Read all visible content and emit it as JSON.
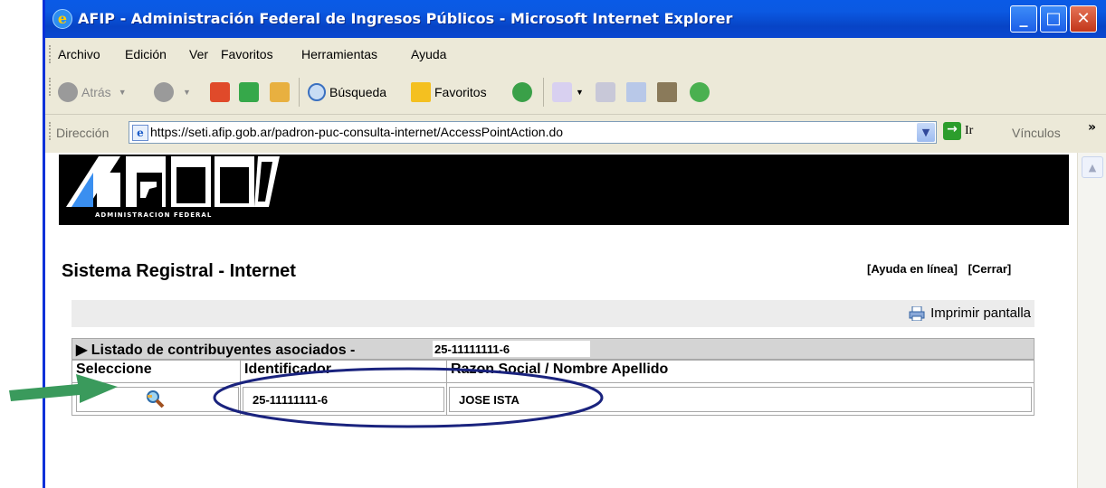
{
  "window": {
    "title": "AFIP - Administración Federal de Ingresos Públicos - Microsoft Internet Explorer",
    "buttons": {
      "minimize": "_",
      "maximize": "□",
      "close": "✕"
    }
  },
  "menu": {
    "items": [
      "Archivo",
      "Edición",
      "Ver",
      "Favoritos",
      "Herramientas",
      "Ayuda"
    ]
  },
  "toolbar": {
    "back": "Atrás",
    "search": "Búsqueda",
    "favorites": "Favoritos"
  },
  "address": {
    "label": "Dirección",
    "url": "https://seti.afip.gob.ar/padron-puc-consulta-internet/AccessPointAction.do",
    "go": "Ir",
    "links": "Vínculos",
    "more": "»"
  },
  "page": {
    "logo_caption": "ADMINISTRACION FEDERAL",
    "title": "Sistema Registral - Internet",
    "help_link": "[Ayuda en línea]",
    "close_link": "[Cerrar]",
    "print": "Imprimir pantalla",
    "list": {
      "title": "▶ Listado de contribuyentes asociados -",
      "cuit": "25-11111111-6",
      "columns": [
        "Seleccione",
        "Identificador",
        "Razon Social / Nombre Apellido"
      ],
      "rows": [
        {
          "id": "25-11111111-6",
          "name": "JOSE ISTA"
        }
      ]
    }
  },
  "colors": {
    "title_bar": "#0a5ae6",
    "arrow": "#3a9a5c",
    "ellipse": "#1a237e",
    "banner": "#000000"
  }
}
